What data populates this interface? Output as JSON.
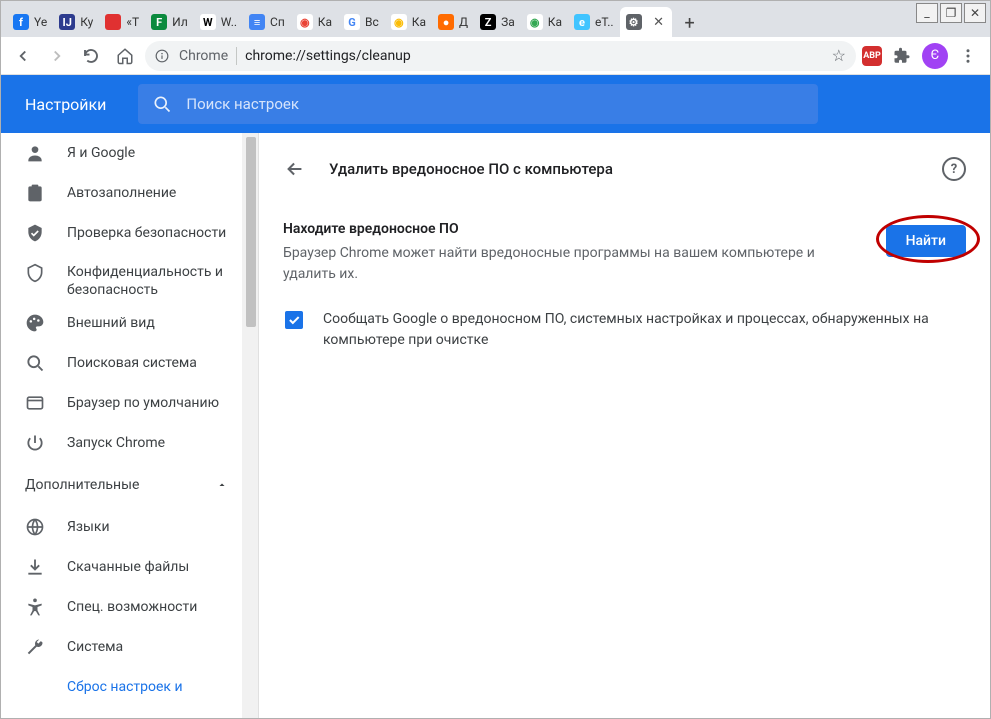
{
  "window": {
    "min": "_",
    "max": "❐",
    "close": "✕"
  },
  "tabs": [
    {
      "favicon_bg": "#1877f2",
      "favicon_txt": "f",
      "title": "Ye"
    },
    {
      "favicon_bg": "#2d3b8e",
      "favicon_txt": "IJ",
      "title": "Ку"
    },
    {
      "favicon_bg": "#e03131",
      "favicon_txt": "",
      "title": "«Т"
    },
    {
      "favicon_bg": "#0b8a3e",
      "favicon_txt": "F",
      "title": "Ил"
    },
    {
      "favicon_bg": "#ffffff",
      "favicon_txt": "W",
      "favicon_fg": "#000",
      "title": "W.."
    },
    {
      "favicon_bg": "#4285f4",
      "favicon_txt": "≡",
      "title": "Сп"
    },
    {
      "favicon_bg": "#ffffff",
      "favicon_txt": "◉",
      "favicon_fg": "#ea4335",
      "title": "Ка"
    },
    {
      "favicon_bg": "#ffffff",
      "favicon_txt": "G",
      "favicon_fg": "#4285f4",
      "title": "Вс"
    },
    {
      "favicon_bg": "#ffffff",
      "favicon_txt": "◉",
      "favicon_fg": "#fbbc04",
      "title": "Ка"
    },
    {
      "favicon_bg": "#ff6b00",
      "favicon_txt": "●",
      "title": "Д"
    },
    {
      "favicon_bg": "#000000",
      "favicon_txt": "Z",
      "title": "За"
    },
    {
      "favicon_bg": "#ffffff",
      "favicon_txt": "◉",
      "favicon_fg": "#34a853",
      "title": "Ка"
    },
    {
      "favicon_bg": "#40c4ff",
      "favicon_txt": "e",
      "title": "eT.."
    },
    {
      "favicon_bg": "#5f6368",
      "favicon_txt": "⚙",
      "title": "",
      "active": true,
      "closeable": true
    }
  ],
  "toolbar": {
    "chip": "Chrome",
    "url": "chrome://settings/cleanup"
  },
  "header": {
    "title": "Настройки",
    "search_placeholder": "Поиск настроек"
  },
  "sidebar": {
    "items": [
      {
        "icon": "person",
        "label": "Я и Google"
      },
      {
        "icon": "clipboard",
        "label": "Автозаполнение"
      },
      {
        "icon": "shield-check",
        "label": "Проверка безопасности"
      },
      {
        "icon": "shield",
        "label": "Конфиденциальность и безопасность",
        "tall": true
      },
      {
        "icon": "palette",
        "label": "Внешний вид"
      },
      {
        "icon": "search",
        "label": "Поисковая система"
      },
      {
        "icon": "browser",
        "label": "Браузер по умолчанию"
      },
      {
        "icon": "power",
        "label": "Запуск Chrome"
      }
    ],
    "adv_label": "Дополнительные",
    "adv_items": [
      {
        "icon": "globe",
        "label": "Языки"
      },
      {
        "icon": "download",
        "label": "Скачанные файлы"
      },
      {
        "icon": "accessibility",
        "label": "Спец. возможности"
      },
      {
        "icon": "wrench",
        "label": "Система"
      }
    ],
    "reset_label": "Сброс настроек и"
  },
  "main": {
    "page_title": "Удалить вредоносное ПО с компьютера",
    "section_heading": "Находите вредоносное ПО",
    "section_desc": "Браузер Chrome может найти вредоносные программы на вашем компьютере и удалить их.",
    "find_button": "Найти",
    "checkbox_label": "Сообщать Google о вредоносном ПО, системных настройках и процессах, обнаруженных на компьютере при очистке"
  }
}
